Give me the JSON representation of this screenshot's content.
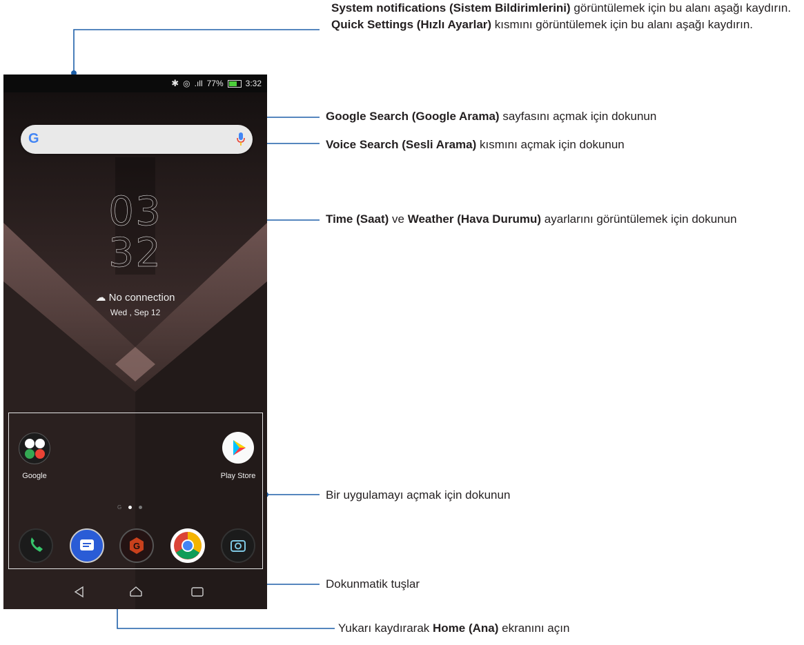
{
  "status_bar": {
    "signal": ".ıll",
    "battery": "77%",
    "time": "3:32"
  },
  "search": {
    "logo": "G"
  },
  "clock": {
    "hours": "03",
    "minutes": "32"
  },
  "weather": {
    "condition": "No connection",
    "date": "Wed , Sep 12"
  },
  "apps": {
    "folder_label": "Google",
    "playstore_label": "Play Store",
    "page_indicator_g": "G"
  },
  "dock": {
    "icons": [
      "phone-icon",
      "messages-icon",
      "game-center-icon",
      "chrome-icon",
      "camera-icon"
    ]
  },
  "nav": {
    "icons": [
      "back-icon",
      "home-icon",
      "recents-icon"
    ]
  },
  "annotations": {
    "notif_b": "System notifications (Sistem Bildirimlerini)",
    "notif_t": " görüntülemek için bu alanı aşağı kaydırın.",
    "quick_b": "Quick Settings (Hızlı Ayarlar)",
    "quick_t": " kısmını görüntülemek için bu alanı aşağı kaydırın.",
    "search_b": "Google Search (Google Arama)",
    "search_t": " sayfasını açmak için dokunun",
    "voice_b": "Voice Search (Sesli Arama)",
    "voice_t": " kısmını açmak için dokunun",
    "time_b1": "Time (Saat)",
    "time_t1": " ve ",
    "time_b2": "Weather (Hava Durumu)",
    "time_t2": " ayarlarını görüntülemek için dokunun",
    "app_t": "Bir uygulamayı açmak için dokunun",
    "keys_t": "Dokunmatik tuşlar",
    "home_t1": "Yukarı kaydırarak ",
    "home_b": "Home (Ana)",
    "home_t2": " ekranını açın"
  },
  "colors": {
    "callout_line": "#1d5fa8",
    "annotation_text": "#231f20",
    "battery": "#4ccf3a"
  }
}
